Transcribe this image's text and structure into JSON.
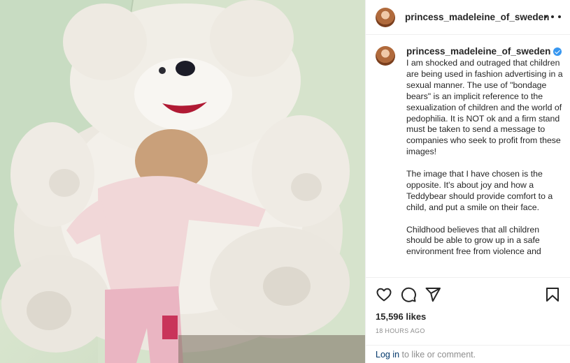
{
  "post": {
    "username": "princess_madeleine_of_sweden",
    "caption_paragraphs": [
      "I am shocked and outraged that children are being used in fashion advertising in a sexual manner. The use of \"bondage bears\" is an implicit reference to the sexualization of children and the world of pedophilia. It is NOT ok and a firm stand must be taken to send a message to companies who seek to profit from these images!",
      "The image that I have chosen is the opposite. It's about joy and how a Teddybear should provide comfort to a child, and put a smile on their face.",
      "Childhood believes that all children should be able to grow up in a safe environment free from violence and"
    ],
    "likes": "15,596 likes",
    "timestamp": "18 HOURS AGO",
    "login": {
      "link_label": "Log in",
      "rest_text": " to like or comment."
    }
  },
  "icons": {
    "more": "more-icon",
    "verified": "verified-badge-icon",
    "like": "heart-icon",
    "comment": "comment-icon",
    "share": "share-icon",
    "save": "bookmark-icon"
  },
  "colors": {
    "verified": "#3897f0",
    "link": "#00376b",
    "muted": "#8e8e8e",
    "text": "#262626"
  }
}
